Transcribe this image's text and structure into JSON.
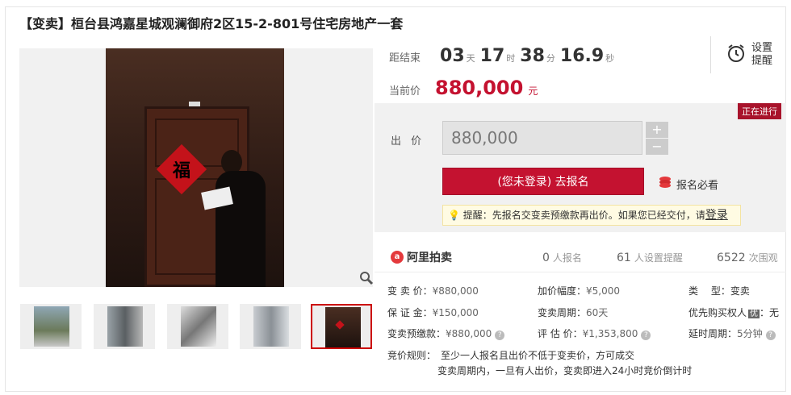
{
  "title": "【变卖】桓台县鸿嘉星城观澜御府2区15-2-801号住宅房地产一套",
  "countdown": {
    "label": "距结束",
    "days": "03",
    "days_unit": "天",
    "hours": "17",
    "hours_unit": "时",
    "minutes": "38",
    "minutes_unit": "分",
    "seconds": "16.9",
    "seconds_unit": "秒"
  },
  "current_price": {
    "label": "当前价",
    "value": "880,000",
    "unit": "元"
  },
  "reminder": {
    "label_line1": "设置",
    "label_line2": "提醒"
  },
  "status_badge": "正在进行",
  "bid": {
    "label": "出 价",
    "value": "880,000",
    "plus": "+",
    "minus": "−"
  },
  "register_button": "(您未登录) 去报名",
  "must_read": "报名必看",
  "tip": {
    "text": "提醒：先报名交变卖预缴款再出价。如果您已经交付，请",
    "login": "登录"
  },
  "platform": "阿里拍卖",
  "stats": [
    {
      "value": "0",
      "label": "人报名"
    },
    {
      "value": "61",
      "label": "人设置提醒"
    },
    {
      "value": "6522",
      "label": "次围观"
    }
  ],
  "info": {
    "sell_price": {
      "key": "变 卖 价：",
      "value": "¥880,000"
    },
    "deposit": {
      "key": "保 证 金：",
      "value": "¥150,000"
    },
    "prepay": {
      "key": "变卖预缴款：",
      "value": "¥880,000"
    },
    "increment": {
      "key": "加价幅度：",
      "value": "¥5,000"
    },
    "period": {
      "key": "变卖周期：",
      "value": "60天"
    },
    "appraisal": {
      "key": "评 估 价：",
      "value": "¥1,353,800"
    },
    "type": {
      "key": "类　 型：",
      "value": "变卖"
    },
    "priority": {
      "key": "优先购买权人",
      "badge": "优",
      "value": "：无"
    },
    "delay": {
      "key": "延时周期：",
      "value": "5分钟"
    }
  },
  "rules": {
    "label": "竞价规则：",
    "line1": "至少一人报名且出价不低于变卖价，方可成交",
    "line2": "变卖周期内，一旦有人出价，变卖即进入24小时竞价倒计时"
  },
  "colors": {
    "accent": "#c41230",
    "status_bg": "#a8132b",
    "tip_bg": "#fffbe3"
  },
  "icons": [
    "zoom-icon",
    "alarm-clock-icon",
    "coins-icon",
    "lightbulb-icon",
    "help-icon",
    "ali-logo-icon"
  ]
}
